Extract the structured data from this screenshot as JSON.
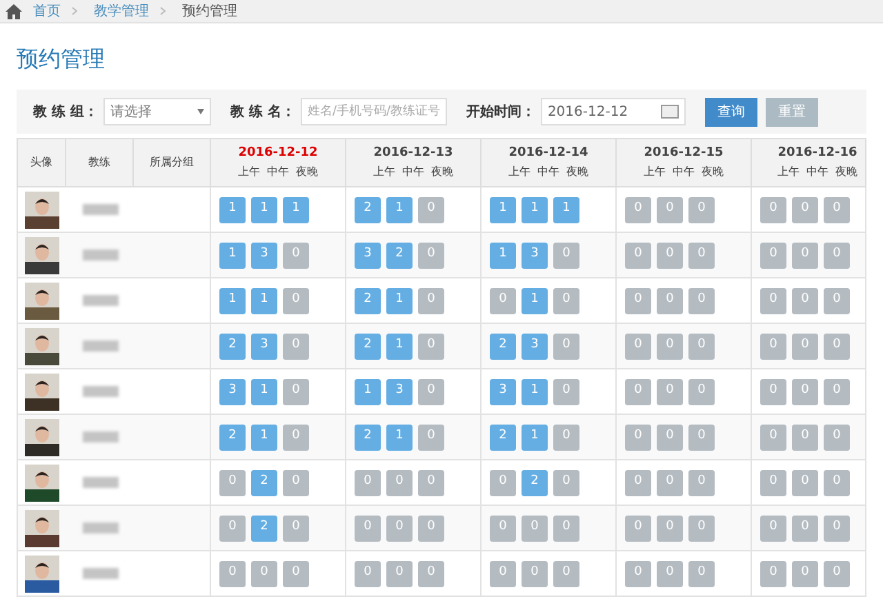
{
  "breadcrumb": [
    "首页",
    "教学管理",
    "预约管理"
  ],
  "page_title": "预约管理",
  "filters": {
    "group_label": "教 练 组：",
    "group_select": "请选择",
    "name_label": "教 练 名：",
    "name_placeholder": "姓名/手机号码/教练证号",
    "start_label": "开始时间：",
    "start_value": "2016-12-12"
  },
  "buttons": [
    "查询",
    "重置"
  ],
  "table": {
    "columns": [
      "头像",
      "教练",
      "所属分组"
    ],
    "days": [
      {
        "date": "2016-12-12",
        "today": true,
        "slots": [
          "上午",
          "中午",
          "夜晚"
        ]
      },
      {
        "date": "2016-12-13",
        "today": false,
        "slots": [
          "上午",
          "中午",
          "夜晚"
        ]
      },
      {
        "date": "2016-12-14",
        "today": false,
        "slots": [
          "上午",
          "中午",
          "夜晚"
        ]
      },
      {
        "date": "2016-12-15",
        "today": false,
        "slots": [
          "上午",
          "中午",
          "夜晚"
        ]
      },
      {
        "date": "2016-12-16",
        "today": false,
        "slots": [
          "上午",
          "中午",
          "夜晚"
        ]
      }
    ],
    "rows": [
      {
        "counts": [
          [
            "1",
            "1",
            "1"
          ],
          [
            "2",
            "1",
            "0"
          ],
          [
            "1",
            "1",
            "1"
          ],
          [
            "0",
            "0",
            "0"
          ],
          [
            "0",
            "0",
            "0"
          ]
        ]
      },
      {
        "counts": [
          [
            "1",
            "3",
            "0"
          ],
          [
            "3",
            "2",
            "0"
          ],
          [
            "1",
            "3",
            "0"
          ],
          [
            "0",
            "0",
            "0"
          ],
          [
            "0",
            "0",
            "0"
          ]
        ]
      },
      {
        "counts": [
          [
            "1",
            "1",
            "0"
          ],
          [
            "2",
            "1",
            "0"
          ],
          [
            "0",
            "1",
            "0"
          ],
          [
            "0",
            "0",
            "0"
          ],
          [
            "0",
            "0",
            "0"
          ]
        ]
      },
      {
        "counts": [
          [
            "2",
            "3",
            "0"
          ],
          [
            "2",
            "1",
            "0"
          ],
          [
            "2",
            "3",
            "0"
          ],
          [
            "0",
            "0",
            "0"
          ],
          [
            "0",
            "0",
            "0"
          ]
        ]
      },
      {
        "counts": [
          [
            "3",
            "1",
            "0"
          ],
          [
            "1",
            "3",
            "0"
          ],
          [
            "3",
            "1",
            "0"
          ],
          [
            "0",
            "0",
            "0"
          ],
          [
            "0",
            "0",
            "0"
          ]
        ]
      },
      {
        "counts": [
          [
            "2",
            "1",
            "0"
          ],
          [
            "2",
            "1",
            "0"
          ],
          [
            "2",
            "1",
            "0"
          ],
          [
            "0",
            "0",
            "0"
          ],
          [
            "0",
            "0",
            "0"
          ]
        ]
      },
      {
        "counts": [
          [
            "0",
            "2",
            "0"
          ],
          [
            "0",
            "0",
            "0"
          ],
          [
            "0",
            "2",
            "0"
          ],
          [
            "0",
            "0",
            "0"
          ],
          [
            "0",
            "0",
            "0"
          ]
        ]
      },
      {
        "counts": [
          [
            "0",
            "2",
            "0"
          ],
          [
            "0",
            "0",
            "0"
          ],
          [
            "0",
            "0",
            "0"
          ],
          [
            "0",
            "0",
            "0"
          ],
          [
            "0",
            "0",
            "0"
          ]
        ]
      },
      {
        "counts": [
          [
            "0",
            "0",
            "0"
          ],
          [
            "0",
            "0",
            "0"
          ],
          [
            "0",
            "0",
            "0"
          ],
          [
            "0",
            "0",
            "0"
          ],
          [
            "0",
            "0",
            "0"
          ]
        ]
      }
    ]
  }
}
